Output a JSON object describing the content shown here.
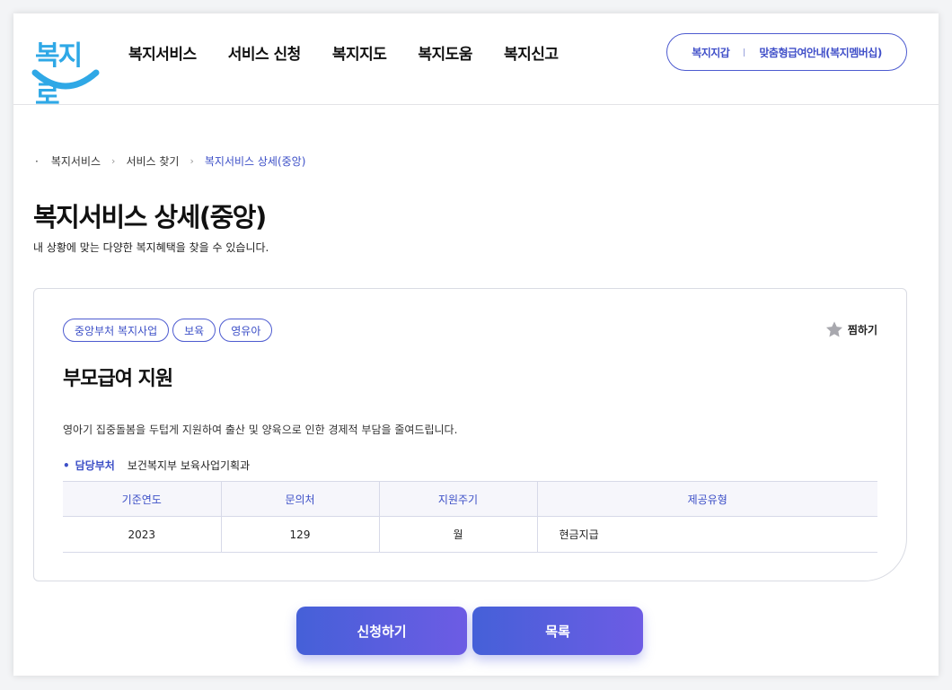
{
  "header": {
    "logo_text": "복지로",
    "nav": [
      "복지서비스",
      "서비스 신청",
      "복지지도",
      "복지도움",
      "복지신고"
    ],
    "pill_links": [
      "복지지갑",
      "맞춤형급여안내(복지멤버십)"
    ]
  },
  "breadcrumb": [
    "복지서비스",
    "서비스 찾기",
    "복지서비스 상세(중앙)"
  ],
  "page": {
    "title": "복지서비스 상세(중앙)",
    "subtitle": "내 상황에 맞는 다양한 복지혜택을 찾을 수 있습니다."
  },
  "service": {
    "tags": [
      "중앙부처 복지사업",
      "보육",
      "영유아"
    ],
    "favorite_label": "찜하기",
    "title": "부모급여 지원",
    "description": "영아기 집중돌봄을 두텁게 지원하여 출산 및 양육으로 인한 경제적 부담을 줄여드립니다.",
    "dept_label": "담당부처",
    "dept_value": "보건복지부 보육사업기획과",
    "table": {
      "headers": [
        "기준연도",
        "문의처",
        "지원주기",
        "제공유형"
      ],
      "row": [
        "2023",
        "129",
        "월",
        "현금지급"
      ]
    }
  },
  "buttons": {
    "apply": "신청하기",
    "list": "목록"
  },
  "colors": {
    "accent": "#3c4fc7",
    "logo": "#2fa8e6",
    "button_start": "#4560d8",
    "button_end": "#6d5ce4"
  }
}
